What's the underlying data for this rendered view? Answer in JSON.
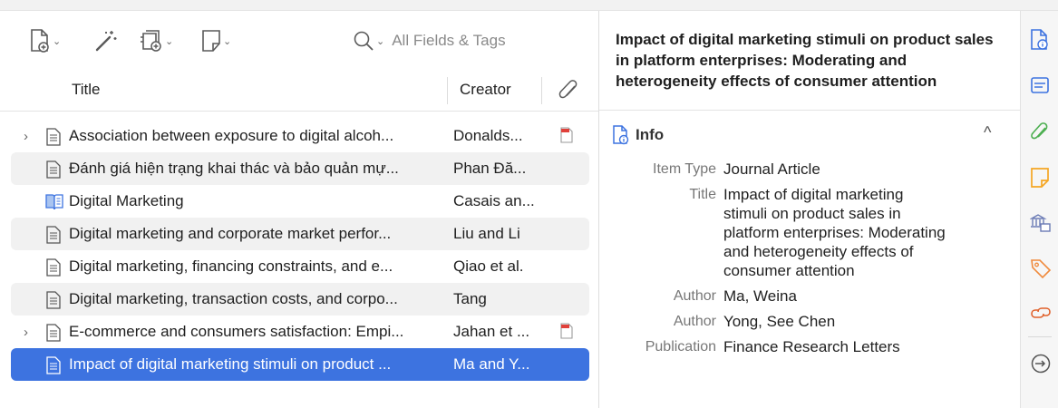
{
  "toolbar": {
    "search_placeholder": "All Fields & Tags"
  },
  "columns": {
    "title": "Title",
    "creator": "Creator"
  },
  "rows": [
    {
      "title": "Association between exposure to digital alcoh...",
      "creator": "Donalds...",
      "expandable": true,
      "pdf": true,
      "icon": "document-icon"
    },
    {
      "title": "Đánh giá hiện trạng khai thác và bảo quản mự...",
      "creator": "Phan Đă...",
      "expandable": false,
      "pdf": false,
      "icon": "document-icon"
    },
    {
      "title": "Digital Marketing",
      "creator": "Casais an...",
      "expandable": false,
      "pdf": false,
      "icon": "book-icon"
    },
    {
      "title": "Digital marketing and corporate market perfor...",
      "creator": "Liu and Li",
      "expandable": false,
      "pdf": false,
      "icon": "document-icon"
    },
    {
      "title": "Digital marketing, financing constraints, and e...",
      "creator": "Qiao et al.",
      "expandable": false,
      "pdf": false,
      "icon": "document-icon"
    },
    {
      "title": "Digital marketing, transaction costs, and corpo...",
      "creator": "Tang",
      "expandable": false,
      "pdf": false,
      "icon": "document-icon"
    },
    {
      "title": "E-commerce and consumers satisfaction: Empi...",
      "creator": "Jahan et ...",
      "expandable": true,
      "pdf": true,
      "icon": "document-icon"
    },
    {
      "title": "Impact of digital marketing stimuli on product ...",
      "creator": "Ma and Y...",
      "expandable": false,
      "pdf": false,
      "icon": "document-icon",
      "selected": true
    }
  ],
  "item_pane": {
    "header_title": "Impact of digital marketing stimuli on product sales in platform enterprises: Moderating and heterogeneity effects of consumer attention",
    "section_label": "Info",
    "fields": [
      {
        "key": "Item Type",
        "value": "Journal Article"
      },
      {
        "key": "Title",
        "value": "Impact of digital marketing stimuli on product sales in platform enterprises: Moderating and heterogeneity effects of consumer attention"
      },
      {
        "key": "Author",
        "value": "Ma, Weina"
      },
      {
        "key": "Author",
        "value": "Yong, See Chen"
      },
      {
        "key": "Publication",
        "value": "Finance Research Letters"
      }
    ]
  },
  "colors": {
    "selection": "#3d73e0",
    "sidenav_icons": [
      "#3d73e0",
      "#3d73e0",
      "#4caf50",
      "#f5a623",
      "#6b7bb5",
      "#f08a3c",
      "#e0602a",
      "#555555"
    ]
  }
}
